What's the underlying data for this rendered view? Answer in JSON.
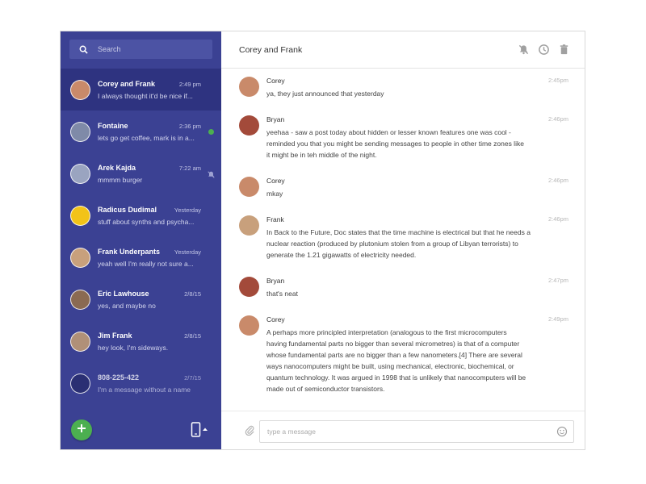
{
  "sidebar": {
    "search_placeholder": "Search",
    "conversations": [
      {
        "name": "Corey and Frank",
        "time": "2:49 pm",
        "preview": "I always thought it'd be nice if...",
        "avatar_color": "#c98a6a",
        "active": true
      },
      {
        "name": "Fontaine",
        "time": "2:36 pm",
        "preview": "lets go get coffee, mark is in a...",
        "avatar_color": "#7f8aa8",
        "unread_dot": true
      },
      {
        "name": "Arek Kajda",
        "time": "7:22 am",
        "preview": "mmmm burger",
        "avatar_color": "#9aa4c0",
        "muted": true
      },
      {
        "name": "Radicus Dudimal",
        "time": "Yesterday",
        "preview": "stuff about synths and psycha...",
        "avatar_color": "#f2c318"
      },
      {
        "name": "Frank Underpants",
        "time": "Yesterday",
        "preview": "yeah well I'm really not sure a...",
        "avatar_color": "#c8a07c"
      },
      {
        "name": "Eric Lawhouse",
        "time": "2/8/15",
        "preview": "yes, and maybe no",
        "avatar_color": "#8a6a52"
      },
      {
        "name": "Jim Frank",
        "time": "2/8/15",
        "preview": "hey look, I'm sideways.",
        "avatar_color": "#b09078"
      },
      {
        "name": "808-225-422",
        "time": "2/7/15",
        "preview": "I'm a message without a name",
        "avatar_color": "#2a2f73",
        "dim": true
      }
    ]
  },
  "header": {
    "title": "Corey and Frank",
    "icons": [
      "mute-icon",
      "clock-icon",
      "trash-icon"
    ]
  },
  "messages": [
    {
      "sender": "Corey",
      "time": "2:45pm",
      "avatar_color": "#c98a6a",
      "lines": [
        "ya, they just announced that yesterday"
      ]
    },
    {
      "sender": "Bryan",
      "time": "2:46pm",
      "avatar_color": "#a34a3a",
      "lines": [
        "yeehaa - saw a post today about hidden or lesser known features one was cool -",
        "reminded you that you might be sending messages to people in other time zones like",
        "it might be in teh middle of the night."
      ]
    },
    {
      "sender": "Corey",
      "time": "2:46pm",
      "avatar_color": "#c98a6a",
      "lines": [
        "mkay"
      ]
    },
    {
      "sender": "Frank",
      "time": "2:46pm",
      "avatar_color": "#c8a07c",
      "lines": [
        "In Back to the Future, Doc states that the time machine is electrical but that he needs a",
        "nuclear reaction (produced by plutonium stolen from a group of Libyan terrorists) to",
        "generate the 1.21 gigawatts of electricity needed."
      ]
    },
    {
      "sender": "Bryan",
      "time": "2:47pm",
      "avatar_color": "#a34a3a",
      "lines": [
        "that's neat"
      ]
    },
    {
      "sender": "Corey",
      "time": "2:49pm",
      "avatar_color": "#c98a6a",
      "lines": [
        "A perhaps more principled interpretation (analogous to the first microcomputers",
        "having fundamental parts no bigger than several micrometres) is that of a computer",
        "whose fundamental parts are no bigger than a few nanometers.[4] There are several",
        "ways nanocomputers might be built, using mechanical, electronic, biochemical, or",
        "quantum technology. It was argued in 1998 that is unlikely that nanocomputers will be",
        "made out of semiconductor transistors."
      ]
    }
  ],
  "composer": {
    "placeholder": "type a message"
  },
  "colors": {
    "sidebar": "#3b4193",
    "sidebar_active": "#2e3380",
    "accent_green": "#4caf50"
  }
}
